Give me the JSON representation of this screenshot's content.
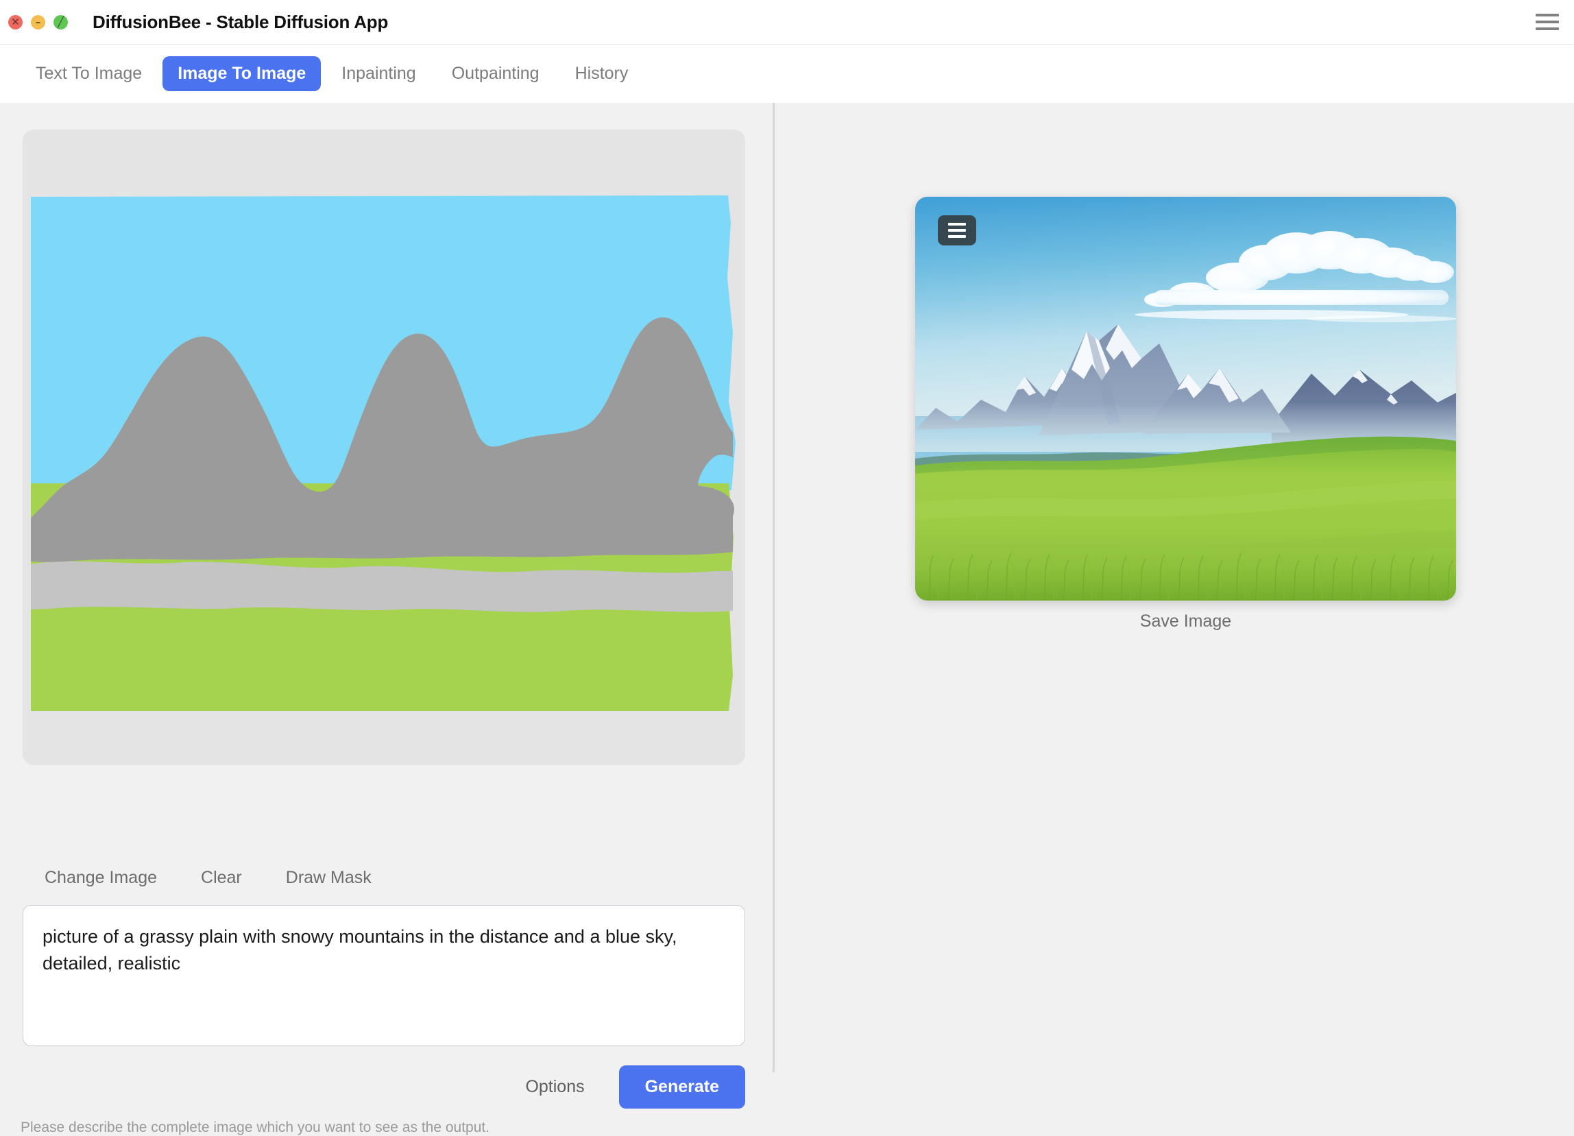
{
  "window": {
    "title": "DiffusionBee - Stable Diffusion App",
    "traffic_lights": [
      {
        "name": "close",
        "glyph": "✕",
        "color": "#ec6a5f"
      },
      {
        "name": "minimize",
        "glyph": "–",
        "color": "#f4bd4f"
      },
      {
        "name": "maximize",
        "glyph": "╱",
        "color": "#61c554"
      }
    ],
    "menu_icon": "hamburger-menu-icon"
  },
  "tabs": [
    {
      "label": "Text To Image",
      "active": false
    },
    {
      "label": "Image To Image",
      "active": true
    },
    {
      "label": "Inpainting",
      "active": false
    },
    {
      "label": "Outpainting",
      "active": false
    },
    {
      "label": "History",
      "active": false
    }
  ],
  "left": {
    "image_actions": [
      {
        "label": "Change Image"
      },
      {
        "label": "Clear"
      },
      {
        "label": "Draw Mask"
      }
    ],
    "prompt": {
      "value": "picture of a grassy plain with snowy mountains in the distance and a blue sky, detailed, realistic",
      "placeholder": "Enter prompt"
    },
    "options_label": "Options",
    "generate_label": "Generate",
    "helper_text": "Please describe the complete image which you want to see as the output.",
    "sketch": {
      "description": "hand-drawn sketch of mountains over a grassy plain under a blue sky",
      "colors": {
        "sky": "#7ed8f7",
        "mountain": "#9b9b9b",
        "ridge": "#c4c4c4",
        "grass": "#a5d24f",
        "canvas_bg": "#e4e4e4"
      }
    }
  },
  "right": {
    "result_menu_icon": "hamburger-menu-icon",
    "save_label": "Save Image",
    "result_image": {
      "description": "AI generated landscape: snowy mountain range behind a rolling green grassy plain with blue sky and clouds",
      "colors": {
        "sky_top": "#4ea8da",
        "sky_bottom": "#cfe9f2",
        "mountain_far": "#6d7fa3",
        "mountain_snow": "#f2f5fa",
        "grass_light": "#a8d44a",
        "grass_dark": "#6aa32c",
        "cloud": "#ffffff"
      }
    }
  },
  "theme": {
    "accent": "#4b72ef",
    "background": "#f1f1f1",
    "panel": "#ffffff",
    "divider": "#d6d6d6",
    "muted_text": "#6d6d6d"
  }
}
